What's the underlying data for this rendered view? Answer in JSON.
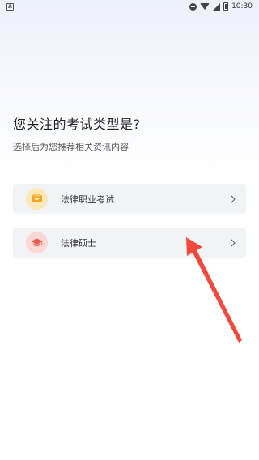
{
  "status_bar": {
    "app_mark": "A",
    "time": "10:30"
  },
  "header": {
    "title": "您关注的考试类型是?",
    "subtitle": "选择后为您推荐相关资讯内容"
  },
  "options": [
    {
      "label": "法律职业考试",
      "icon": "book-icon",
      "accent": "#f5a623"
    },
    {
      "label": "法律硕士",
      "icon": "graduation-cap-icon",
      "accent": "#e85a4f"
    }
  ],
  "annotation": {
    "arrow_color": "#f04a3e"
  }
}
